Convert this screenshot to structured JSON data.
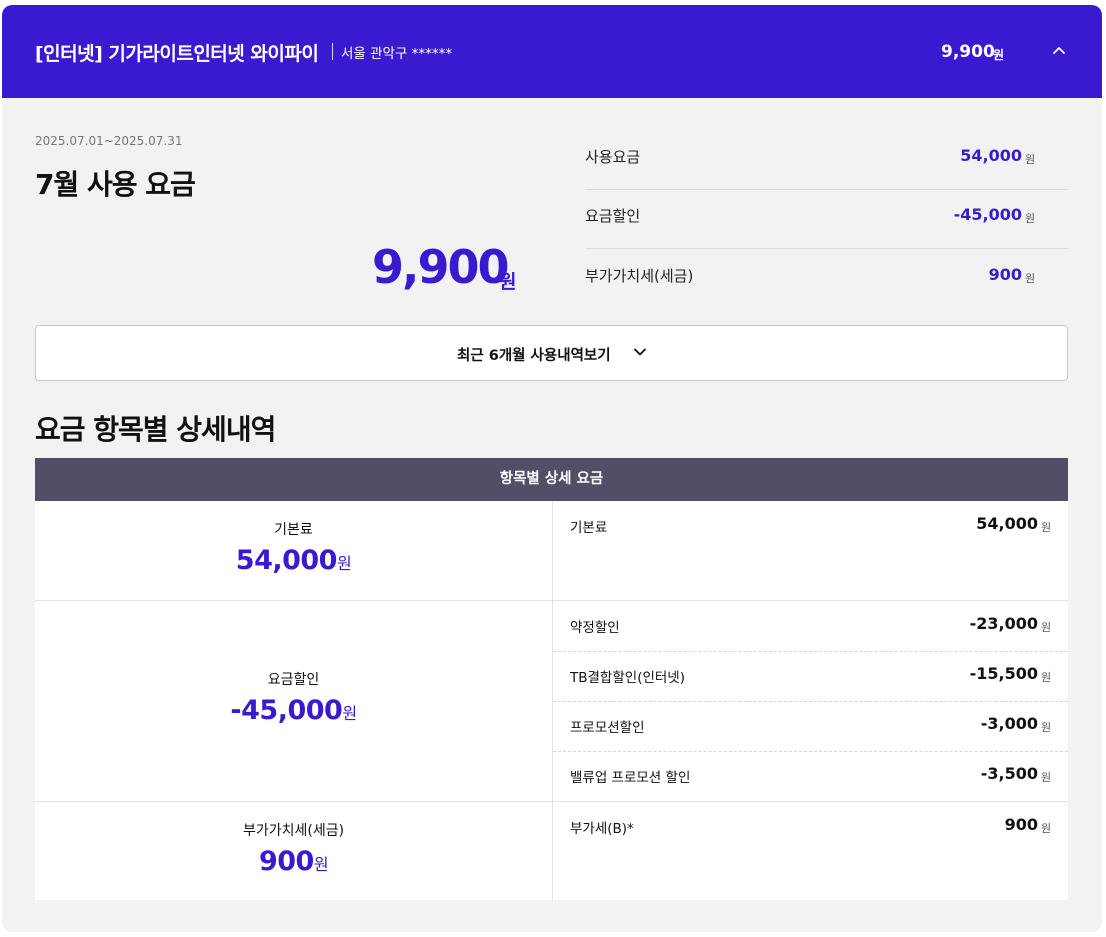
{
  "header": {
    "title": "[인터넷] 기가라이트인터넷 와이파이",
    "address": "서울 관악구 ******",
    "total": "9,900",
    "unit": "원",
    "collapse_icon": "chevron-up-icon"
  },
  "summary": {
    "period": "2025.07.01~2025.07.31",
    "title": "7월 사용 요금",
    "amount": "9,900",
    "unit": "원",
    "rows": [
      {
        "label": "사용요금",
        "value": "54,000",
        "unit": "원"
      },
      {
        "label": "요금할인",
        "value": "-45,000",
        "unit": "원"
      },
      {
        "label": "부가가치세(세금)",
        "value": "900",
        "unit": "원"
      }
    ]
  },
  "history_button": {
    "label": "최근 6개월 사용내역보기",
    "icon": "chevron-down-icon"
  },
  "detail": {
    "section_title": "요금 항목별 상세내역",
    "table_header": "항목별 상세 요금",
    "groups": [
      {
        "label": "기본료",
        "value": "54,000",
        "unit": "원",
        "items": [
          {
            "label": "기본료",
            "value": "54,000",
            "unit": "원"
          }
        ]
      },
      {
        "label": "요금할인",
        "value": "-45,000",
        "unit": "원",
        "items": [
          {
            "label": "약정할인",
            "value": "-23,000",
            "unit": "원"
          },
          {
            "label": "TB결합할인(인터넷)",
            "value": "-15,500",
            "unit": "원"
          },
          {
            "label": "프로모션할인",
            "value": "-3,000",
            "unit": "원"
          },
          {
            "label": "밸류업 프로모션 할인",
            "value": "-3,500",
            "unit": "원"
          }
        ]
      },
      {
        "label": "부가가치세(세금)",
        "value": "900",
        "unit": "원",
        "items": [
          {
            "label": "부가세(B)*",
            "value": "900",
            "unit": "원"
          }
        ]
      }
    ]
  },
  "colors": {
    "brand": "#3a1ad0",
    "table_header": "#514e67",
    "background": "#f2f2f2"
  }
}
